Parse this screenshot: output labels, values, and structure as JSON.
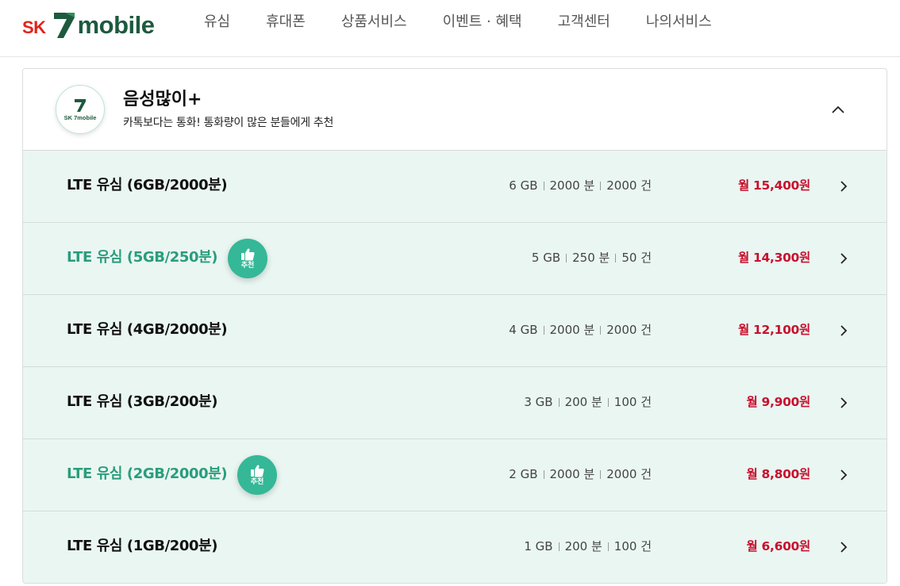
{
  "header": {
    "logo_prefix": "SK",
    "logo_text": "mobile",
    "nav": [
      "유심",
      "휴대폰",
      "상품서비스",
      "이벤트 · 혜택",
      "고객센터",
      "나의서비스"
    ]
  },
  "plan": {
    "badge_text": "SK 7mobile",
    "title": "음성많이+",
    "description": "카톡보다는 통화! 통화량이 많은 분들에게 추천"
  },
  "rows": [
    {
      "name": "LTE 유심 (6GB/2000분)",
      "recommended": false,
      "data": "6 GB",
      "voice": "2000 분",
      "sms": "2000 건",
      "price": "월 15,400원"
    },
    {
      "name": "LTE 유심 (5GB/250분)",
      "recommended": true,
      "data": "5 GB",
      "voice": "250 분",
      "sms": "50 건",
      "price": "월 14,300원"
    },
    {
      "name": "LTE 유심 (4GB/2000분)",
      "recommended": false,
      "data": "4 GB",
      "voice": "2000 분",
      "sms": "2000 건",
      "price": "월 12,100원"
    },
    {
      "name": "LTE 유심 (3GB/200분)",
      "recommended": false,
      "data": "3 GB",
      "voice": "200 분",
      "sms": "100 건",
      "price": "월 9,900원"
    },
    {
      "name": "LTE 유심 (2GB/2000분)",
      "recommended": true,
      "data": "2 GB",
      "voice": "2000 분",
      "sms": "2000 건",
      "price": "월 8,800원"
    },
    {
      "name": "LTE 유심 (1GB/200분)",
      "recommended": false,
      "data": "1 GB",
      "voice": "200 분",
      "sms": "100 건",
      "price": "월 6,600원"
    }
  ],
  "recommend_label": "추천",
  "colors": {
    "brand_green": "#1d5a3e",
    "brand_red": "#e2231a",
    "accent_teal": "#35b897",
    "recommended_text": "#2a9d7c",
    "price_red": "#c8102e",
    "row_bg": "#eaf6f2"
  },
  "icons": {
    "logo": "sk-7mobile-logo",
    "collapse": "chevron-up-icon",
    "row_arrow": "chevron-right-icon",
    "recommend": "thumbs-up-icon"
  }
}
